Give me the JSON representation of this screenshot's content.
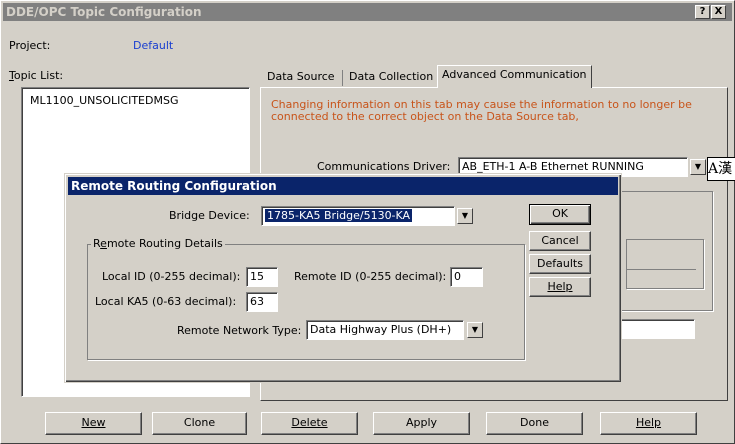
{
  "main_window": {
    "title": "DDE/OPC Topic Configuration",
    "help_btn": "?",
    "close_btn": "X",
    "project_label": "Project:",
    "project_value": "Default",
    "topic_list_label": "Topic List:",
    "topics": [
      "ML1100_UNSOLICITEDMSG"
    ],
    "tabs": [
      "Data Source",
      "Data Collection",
      "Advanced Communication"
    ],
    "warning": "Changing information on this tab may cause the information to no longer be connected to the correct object on the Data Source tab,",
    "driver_label": "Communications Driver:",
    "driver_value": "AB_ETH-1  A-B Ethernet  RUNNING",
    "ime_glyph": "A漢",
    "buttons": {
      "new": "New",
      "clone": "Clone",
      "delete": "Delete",
      "apply": "Apply",
      "done": "Done",
      "help": "Help"
    }
  },
  "dialog": {
    "title": "Remote Routing Configuration",
    "bridge_label": "Bridge Device:",
    "bridge_value": "1785-KA5 Bridge/5130-KA",
    "group_label": "Remote Routing Details",
    "local_id_label": "Local ID (0-255 decimal):",
    "local_id_value": "15",
    "remote_id_label": "Remote ID (0-255 decimal):",
    "remote_id_value": "0",
    "local_ka5_label": "Local KA5 (0-63 decimal):",
    "local_ka5_value": "63",
    "network_type_label": "Remote Network Type:",
    "network_type_value": "Data Highway Plus (DH+)",
    "buttons": {
      "ok": "OK",
      "cancel": "Cancel",
      "defaults": "Defaults",
      "help": "Help"
    }
  }
}
